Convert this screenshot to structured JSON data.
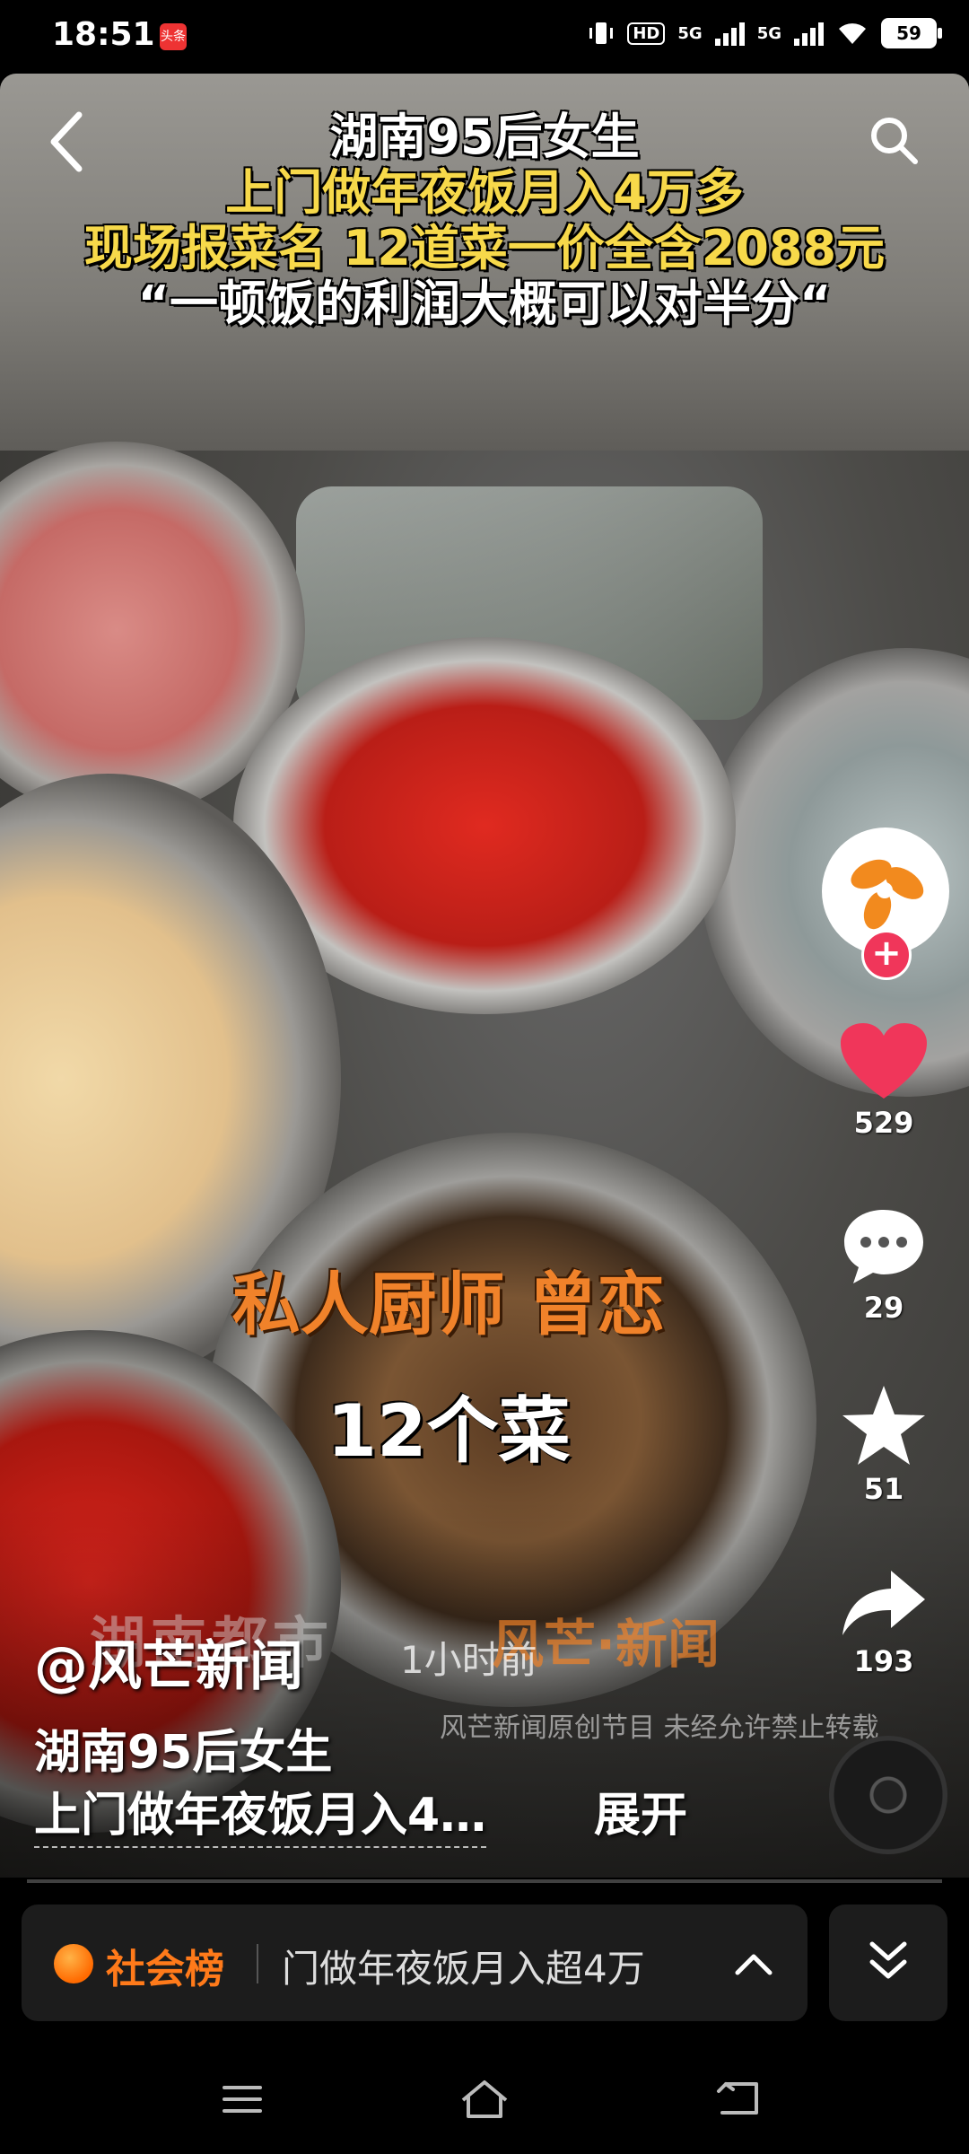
{
  "status_bar": {
    "time": "18:51",
    "app_badge": "头条",
    "hd_label": "HD",
    "signal1_label": "5G",
    "signal2_label": "5G",
    "battery": "59"
  },
  "video": {
    "caption_lines": [
      "湖南95后女生",
      "上门做年夜饭月入4万多",
      "现场报菜名 12道菜一价全含2088元",
      "“一顿饭的利润大概可以对半分“"
    ],
    "overlay_chef": "私人厨师 曾恋",
    "overlay_count": "12个菜",
    "watermark_source": "湖南都市",
    "watermark_logo": "风芒·新闻",
    "watermark_note": "风芒新闻原创节目 未经允许禁止转载"
  },
  "right_rail": {
    "likes": "529",
    "comments": "29",
    "favorites": "51",
    "shares": "193"
  },
  "post": {
    "author": "@风芒新闻",
    "time_ago": "1小时前",
    "description_line1": "湖南95后女生",
    "description_line2": "上门做年夜饭月入4…",
    "expand_label": "展开"
  },
  "hot_bar": {
    "label": "社会榜",
    "text": "门做年夜饭月入超4万"
  },
  "colors": {
    "accent_orange": "#ff7a1a",
    "like_red": "#f0365a",
    "caption_yellow": "#f7d94a"
  },
  "icons": {
    "back": "back-arrow-icon",
    "search": "search-icon",
    "like": "heart-icon",
    "comment": "comment-icon",
    "favorite": "star-icon",
    "share": "share-icon",
    "hot_expand": "chevron-up-icon",
    "collapse": "double-chevron-down-icon"
  }
}
